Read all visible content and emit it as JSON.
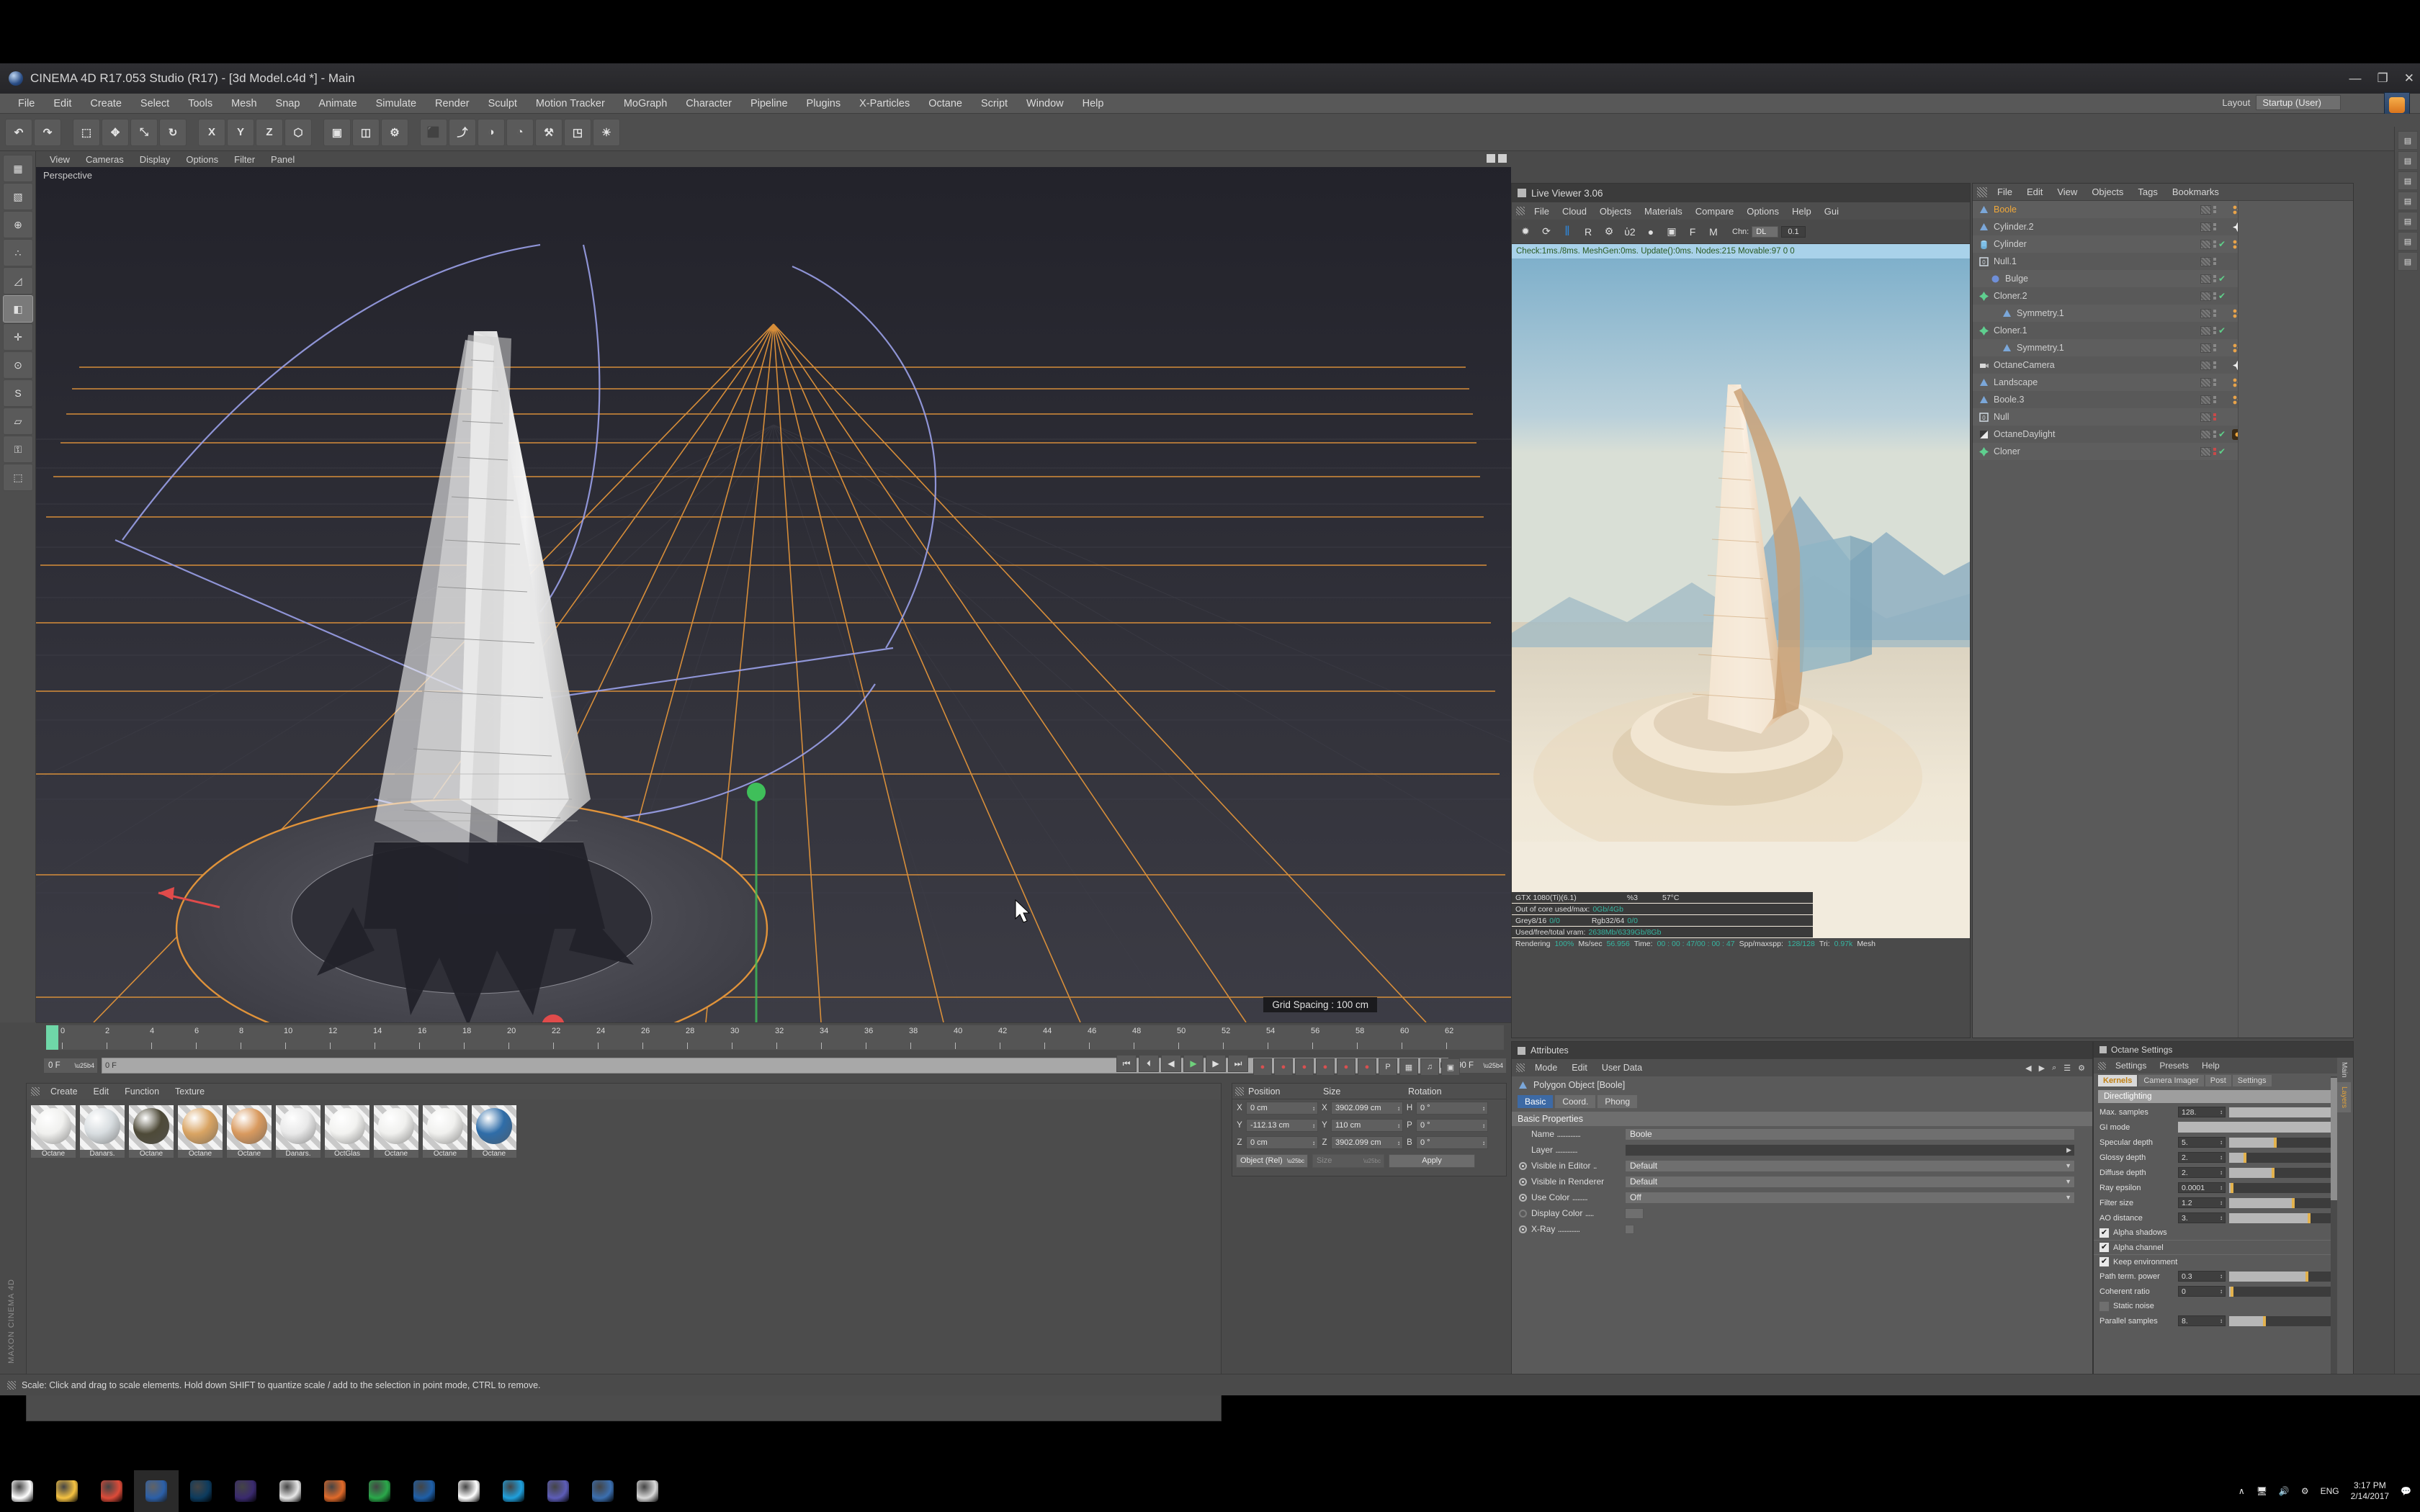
{
  "window": {
    "title": "CINEMA 4D R17.053 Studio (R17) - [3d Model.c4d *] - Main",
    "minimize": "—",
    "maximize": "❐",
    "close": "✕"
  },
  "menubar": {
    "items": [
      "File",
      "Edit",
      "Create",
      "Select",
      "Tools",
      "Mesh",
      "Snap",
      "Animate",
      "Simulate",
      "Render",
      "Sculpt",
      "Motion Tracker",
      "MoGraph",
      "Character",
      "Pipeline",
      "Plugins",
      "X-Particles",
      "Octane",
      "Script",
      "Window",
      "Help"
    ],
    "layout_label": "Layout",
    "layout_value": "Startup (User)"
  },
  "toolbar": {
    "buttons": [
      {
        "name": "undo-button",
        "glyph": "↶"
      },
      {
        "name": "redo-button",
        "glyph": "↷"
      },
      {
        "name": "sep1",
        "glyph": ""
      },
      {
        "name": "live-selection-tool",
        "glyph": "⬚"
      },
      {
        "name": "move-tool",
        "glyph": "✥"
      },
      {
        "name": "scale-tool",
        "glyph": "⤡"
      },
      {
        "name": "rotate-tool",
        "glyph": "↻"
      },
      {
        "name": "sep2",
        "glyph": ""
      },
      {
        "name": "axis-x-button",
        "glyph": "X"
      },
      {
        "name": "axis-y-button",
        "glyph": "Y"
      },
      {
        "name": "axis-z-button",
        "glyph": "Z"
      },
      {
        "name": "world-object-toggle",
        "glyph": "⬡"
      },
      {
        "name": "sep3",
        "glyph": ""
      },
      {
        "name": "render-view-button",
        "glyph": "▣"
      },
      {
        "name": "render-region-button",
        "glyph": "◫"
      },
      {
        "name": "render-settings-button",
        "glyph": "⚙"
      },
      {
        "name": "sep4",
        "glyph": ""
      },
      {
        "name": "cube-primitive-button",
        "glyph": "⬛"
      },
      {
        "name": "spline-button",
        "glyph": "⤴"
      },
      {
        "name": "generator-button",
        "glyph": "◑"
      },
      {
        "name": "deformer-button",
        "glyph": "◔"
      },
      {
        "name": "scene-button",
        "glyph": "⚒"
      },
      {
        "name": "camera-button",
        "glyph": "◳"
      },
      {
        "name": "light-button",
        "glyph": "☀"
      }
    ]
  },
  "left_toolbar": {
    "buttons": [
      {
        "name": "model-mode-button",
        "glyph": "▦"
      },
      {
        "name": "texture-mode-button",
        "glyph": "▧"
      },
      {
        "name": "object-axis-button",
        "glyph": "⊕"
      },
      {
        "name": "point-mode-button",
        "glyph": "∴"
      },
      {
        "name": "edge-mode-button",
        "glyph": "◿"
      },
      {
        "name": "polygon-mode-button",
        "glyph": "◧"
      },
      {
        "name": "enable-axis-button",
        "glyph": "✛"
      },
      {
        "name": "viewport-solo-button",
        "glyph": "⊙"
      },
      {
        "name": "snap-button",
        "glyph": "S"
      },
      {
        "name": "workplane-button",
        "glyph": "▱"
      },
      {
        "name": "lock-button",
        "glyph": "⚿"
      },
      {
        "name": "uv-button",
        "glyph": "⬚"
      }
    ]
  },
  "viewport": {
    "menu": [
      "View",
      "Cameras",
      "Display",
      "Options",
      "Filter",
      "Panel"
    ],
    "label": "Perspective",
    "grid_spacing": "Grid Spacing : 100 cm"
  },
  "live_viewer": {
    "title": "Live Viewer 3.06",
    "menu": [
      "File",
      "Cloud",
      "Objects",
      "Materials",
      "Compare",
      "Options",
      "Help",
      "Gui"
    ],
    "toolbar": [
      {
        "name": "stop-render-icon",
        "glyph": "✹"
      },
      {
        "name": "restart-render-icon",
        "glyph": "⟳"
      },
      {
        "name": "pause-render-icon",
        "glyph": "‖"
      },
      {
        "name": "region-render-icon",
        "glyph": "R"
      },
      {
        "name": "render-settings-icon",
        "glyph": "⚙"
      },
      {
        "name": "lock-resolution-icon",
        "glyph": "ὑ2"
      },
      {
        "name": "material-preview-icon",
        "glyph": "●"
      },
      {
        "name": "picture-viewer-icon",
        "glyph": "▣"
      },
      {
        "name": "focus-picker-icon",
        "glyph": "F"
      },
      {
        "name": "material-picker-icon",
        "glyph": "M"
      }
    ],
    "chn_label": "Chn:",
    "chn_value": "DL",
    "chn_num": "0.1",
    "status": "Check:1ms./8ms. MeshGen:0ms. Update():0ms. Nodes:215 Movable:97  0 0",
    "stats": [
      {
        "label": "GTX 1080(Ti)(6.1)",
        "v1": "%3",
        "v2": "57°C"
      },
      {
        "label": "Out of core used/max:",
        "value": "0Gb/4Gb"
      },
      {
        "label": "Grey8/16",
        "value": "0/0",
        "label2": "Rgb32/64",
        "value2": "0/0"
      },
      {
        "label": "Used/free/total vram:",
        "value": "2638Mb/6339Gb/8Gb"
      }
    ],
    "render_line": {
      "rendering_label": "Rendering",
      "rendering_value": "100%",
      "mssec_label": "Ms/sec",
      "mssec_value": "56.956",
      "time_label": "Time:",
      "time_value": "00 : 00 : 47/00 : 00 : 47",
      "spp_label": "Spp/maxspp:",
      "spp_value": "128/128",
      "tri_label": "Tri:",
      "tri_value": "0.97k",
      "mesh_label": "Mesh"
    }
  },
  "object_manager": {
    "menu": [
      "File",
      "Edit",
      "View",
      "Objects",
      "Tags",
      "Bookmarks"
    ],
    "items": [
      {
        "name": "Boole",
        "icon": "boole",
        "indent": 0,
        "selected": true,
        "tags": [
          "orange-dots",
          "orange-star"
        ]
      },
      {
        "name": "Cylinder.2",
        "icon": "boole",
        "indent": 0,
        "selected": false,
        "tags": [
          "orange-star",
          "orange-dots"
        ]
      },
      {
        "name": "Cylinder",
        "icon": "cylinder",
        "indent": 0,
        "selected": false,
        "tags": [
          "orange-dots"
        ],
        "check": true
      },
      {
        "name": "Null.1",
        "icon": "null",
        "indent": 0,
        "selected": false,
        "tags": []
      },
      {
        "name": "Bulge",
        "icon": "bulge",
        "indent": 1,
        "selected": false,
        "tags": [],
        "check": true
      },
      {
        "name": "Cloner.2",
        "icon": "cloner",
        "indent": 0,
        "selected": false,
        "tags": [],
        "check": true
      },
      {
        "name": "Symmetry.1",
        "icon": "boole",
        "indent": 2,
        "selected": false,
        "tags": [
          "orange-dots",
          "orange-star"
        ]
      },
      {
        "name": "Cloner.1",
        "icon": "cloner",
        "indent": 0,
        "selected": false,
        "tags": [],
        "check": true
      },
      {
        "name": "Symmetry.1",
        "icon": "boole",
        "indent": 2,
        "selected": false,
        "tags": [
          "orange-dots",
          "orange-star"
        ]
      },
      {
        "name": "OctaneCamera",
        "icon": "camera",
        "indent": 0,
        "selected": false,
        "tags": [
          "orange-star",
          "red-cam"
        ]
      },
      {
        "name": "Landscape",
        "icon": "boole",
        "indent": 0,
        "selected": false,
        "tags": [
          "orange-dots",
          "orange-star"
        ]
      },
      {
        "name": "Boole.3",
        "icon": "boole",
        "indent": 0,
        "selected": false,
        "tags": [
          "orange-dots",
          "orange-star"
        ]
      },
      {
        "name": "Null",
        "icon": "null",
        "indent": 0,
        "selected": false,
        "tags": [],
        "red": true
      },
      {
        "name": "OctaneDaylight",
        "icon": "daylight",
        "indent": 0,
        "selected": false,
        "tags": [
          "orange-sq",
          "white-sun"
        ],
        "check": true
      },
      {
        "name": "Cloner",
        "icon": "cloner",
        "indent": 0,
        "selected": false,
        "tags": [],
        "check": true,
        "red": true
      }
    ]
  },
  "attributes": {
    "title": "Attributes",
    "menu": [
      "Mode",
      "Edit",
      "User Data"
    ],
    "object_line": "Polygon Object [Boole]",
    "tabs": [
      "Basic",
      "Coord.",
      "Phong"
    ],
    "active_tab": "Basic",
    "section": "Basic Properties",
    "rows": [
      {
        "label": "Name",
        "value": "Boole",
        "type": "text"
      },
      {
        "label": "Layer",
        "value": "",
        "type": "layer"
      },
      {
        "label": "Visible in Editor",
        "value": "Default",
        "type": "dropdown"
      },
      {
        "label": "Visible in Renderer",
        "value": "Default",
        "type": "dropdown"
      },
      {
        "label": "Use Color",
        "value": "Off",
        "type": "dropdown"
      },
      {
        "label": "Display Color",
        "value": "",
        "type": "swatch"
      },
      {
        "label": "X-Ray",
        "value": "",
        "type": "checkbox"
      }
    ],
    "nav": [
      "◀",
      "▶",
      "⌕",
      "☰",
      "⚙"
    ]
  },
  "octane_settings": {
    "title": "Octane Settings",
    "menu": [
      "Settings",
      "Presets",
      "Help"
    ],
    "tabs": [
      "Kernels",
      "Camera Imager",
      "Post",
      "Settings"
    ],
    "active_tab": "Kernels",
    "section": "Directlighting",
    "rows": [
      {
        "label": "Max. samples",
        "value": "128.",
        "fill": 0,
        "knob": 0,
        "wide": true
      },
      {
        "label": "GI mode",
        "value": "",
        "wideonly": true
      },
      {
        "label": "Specular depth",
        "value": "5.",
        "fill": 40,
        "knob": 40
      },
      {
        "label": "Glossy depth",
        "value": "2.",
        "fill": 13,
        "knob": 13
      },
      {
        "label": "Diffuse depth",
        "value": "2.",
        "fill": 38,
        "knob": 38
      },
      {
        "label": "Ray epsilon",
        "value": "0.0001",
        "fill": 1,
        "knob": 1
      },
      {
        "label": "Filter size",
        "value": "1.2",
        "fill": 56,
        "knob": 56
      },
      {
        "label": "AO distance",
        "value": "3.",
        "fill": 70,
        "knob": 70
      }
    ],
    "checks1": [
      {
        "label": "Alpha shadows",
        "on": true
      }
    ],
    "checks2": [
      {
        "label": "Alpha channel",
        "on": true
      },
      {
        "label": "Keep environment",
        "on": true
      }
    ],
    "rows2": [
      {
        "label": "Path term. power",
        "value": "0.3",
        "fill": 68,
        "knob": 68
      },
      {
        "label": "Coherent ratio",
        "value": "0",
        "fill": 1,
        "knob": 1
      }
    ],
    "checks3": [
      {
        "label": "Static noise",
        "on": false
      }
    ],
    "rows3": [
      {
        "label": "Parallel samples",
        "value": "8.",
        "fill": 30,
        "knob": 30
      }
    ],
    "side_tabs": [
      "Main",
      "Layers"
    ]
  },
  "coordinates": {
    "headers": [
      "Position",
      "Size",
      "Rotation"
    ],
    "rows": [
      {
        "a1": "X",
        "v1": "0 cm",
        "a2": "X",
        "v2": "3902.099 cm",
        "a3": "H",
        "v3": "0 °"
      },
      {
        "a1": "Y",
        "v1": "-112.13 cm",
        "a2": "Y",
        "v2": "110 cm",
        "a3": "P",
        "v3": "0 °"
      },
      {
        "a1": "Z",
        "v1": "0 cm",
        "a2": "Z",
        "v2": "3902.099 cm",
        "a3": "B",
        "v3": "0 °"
      }
    ],
    "mode": "Object (Rel)",
    "size_mode": "Size",
    "apply": "Apply"
  },
  "material_manager": {
    "menu": [
      "Create",
      "Edit",
      "Function",
      "Texture"
    ],
    "materials": [
      {
        "name": "Octane",
        "color": "#f0f0ee"
      },
      {
        "name": "Danars.",
        "color": "#d8dde0"
      },
      {
        "name": "Octane",
        "color": "#4e4a38"
      },
      {
        "name": "Octane",
        "color": "#d9a463"
      },
      {
        "name": "Octane",
        "color": "#d99a5f"
      },
      {
        "name": "Danars.",
        "color": "#e9e9e9"
      },
      {
        "name": "OctGlas",
        "color": "#f2f2f0"
      },
      {
        "name": "Octane",
        "color": "#f0f0ee"
      },
      {
        "name": "Octane",
        "color": "#f0f0ee"
      },
      {
        "name": "Octane",
        "color": "#2f6da8"
      }
    ]
  },
  "timeline": {
    "ticks": [
      "0",
      "2",
      "4",
      "6",
      "8",
      "10",
      "12",
      "14",
      "16",
      "18",
      "20",
      "22",
      "24",
      "26",
      "28",
      "30",
      "32",
      "34",
      "36",
      "38",
      "40",
      "42",
      "44",
      "46",
      "48",
      "50",
      "52",
      "54",
      "56",
      "58",
      "60",
      "62"
    ],
    "current_frame": "0 F",
    "start_frame": "0 F",
    "end_frame": "90 F",
    "max_frame": "90 F",
    "transport": [
      {
        "name": "go-to-start-button",
        "glyph": "⏮"
      },
      {
        "name": "previous-key-button",
        "glyph": "⏴"
      },
      {
        "name": "step-back-button",
        "glyph": "◀"
      },
      {
        "name": "play-button",
        "glyph": "▶"
      },
      {
        "name": "step-forward-button",
        "glyph": "▶"
      },
      {
        "name": "go-to-end-button",
        "glyph": "⏭"
      }
    ],
    "keyrow": [
      {
        "name": "record-keyframe-button",
        "glyph": "●",
        "color": "red"
      },
      {
        "name": "autokey-button",
        "glyph": "●",
        "color": "red"
      },
      {
        "name": "key-position-button",
        "glyph": "●",
        "color": "red"
      },
      {
        "name": "key-scale-button",
        "glyph": "●",
        "color": "red"
      },
      {
        "name": "key-rotation-button",
        "glyph": "●",
        "color": "red"
      },
      {
        "name": "key-param-button",
        "glyph": "●",
        "color": "red"
      },
      {
        "name": "pla-button",
        "glyph": "P",
        "color": "grey"
      },
      {
        "name": "keyframe-select-button",
        "glyph": "▦",
        "color": "grey"
      },
      {
        "name": "sound-button",
        "glyph": "♫",
        "color": "grey"
      },
      {
        "name": "keyframe-mode-button",
        "glyph": "▣",
        "color": "grey"
      }
    ]
  },
  "statusbar": {
    "text": "Scale: Click and drag to scale elements. Hold down SHIFT to quantize scale / add to the selection in point mode, CTRL to remove."
  },
  "right_strip": {
    "buttons": [
      {
        "name": "content-browser-button",
        "glyph": "▤"
      },
      {
        "name": "commander-button",
        "glyph": "▤"
      },
      {
        "name": "structure-button",
        "glyph": "▤"
      },
      {
        "name": "layer-button",
        "glyph": "▤"
      },
      {
        "name": "material-button",
        "glyph": "▤"
      },
      {
        "name": "takes-button",
        "glyph": "▤"
      },
      {
        "name": "scene-nodes-button",
        "glyph": "▤"
      }
    ]
  },
  "watermark": "MAXON CINEMA 4D",
  "taskbar": {
    "items": [
      {
        "name": "start-button",
        "icon": "windows",
        "color": "#ffffff"
      },
      {
        "name": "file-explorer-button",
        "icon": "folder",
        "color": "#f5c242"
      },
      {
        "name": "chrome-button",
        "icon": "chrome",
        "color": "#dd4b39"
      },
      {
        "name": "cinema4d-button",
        "icon": "c4d",
        "color": "#2b5fa8",
        "active": true
      },
      {
        "name": "photoshop-button",
        "icon": "ps",
        "color": "#0c3b5e"
      },
      {
        "name": "aftereffects-button",
        "icon": "ae",
        "color": "#3a2a6e"
      },
      {
        "name": "app6-button",
        "icon": "app6",
        "color": "#e8e8e8"
      },
      {
        "name": "app7-button",
        "icon": "sun",
        "color": "#e06a2a"
      },
      {
        "name": "app8-button",
        "icon": "green",
        "color": "#2aa84a"
      },
      {
        "name": "app9-button",
        "icon": "check",
        "color": "#1e5fa8"
      },
      {
        "name": "mail-button",
        "icon": "mail",
        "color": "#ffffff"
      },
      {
        "name": "skype-button",
        "icon": "skype",
        "color": "#1fa0dd"
      },
      {
        "name": "app12-button",
        "icon": "flower",
        "color": "#5d5db8"
      },
      {
        "name": "app13-button",
        "icon": "blue",
        "color": "#3b6fb0"
      },
      {
        "name": "app14-button",
        "icon": "gear",
        "color": "#d8d8d8"
      }
    ],
    "tray": {
      "chevron": "∧",
      "icons": [
        "network-icon",
        "volume-icon",
        "bluetooth-icon"
      ],
      "language": "ENG",
      "time": "3:17 PM",
      "date": "2/14/2017",
      "notification": "1"
    }
  }
}
